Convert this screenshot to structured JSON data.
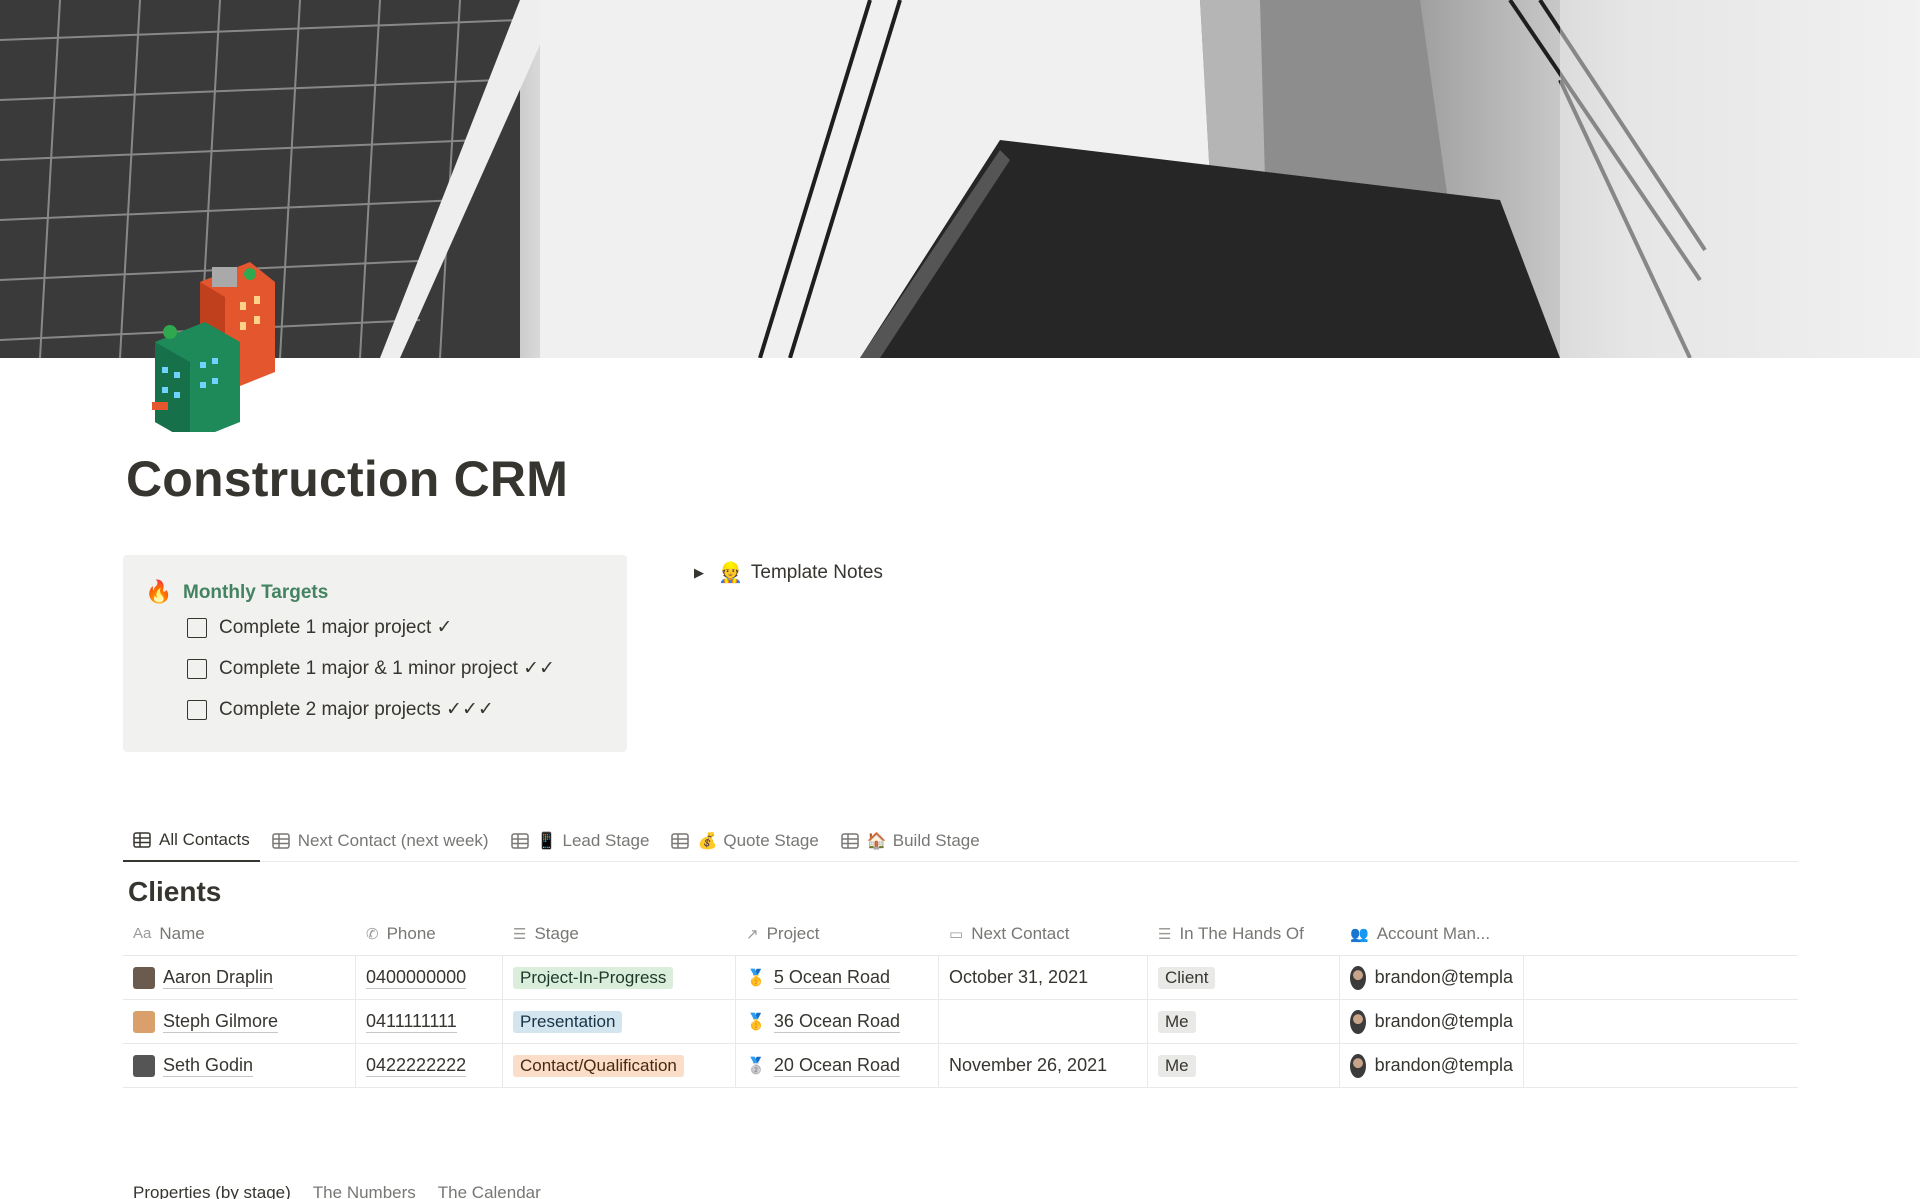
{
  "page": {
    "title": "Construction CRM",
    "cover_alt": "construction-cover",
    "icon": "building-icon"
  },
  "callout": {
    "emoji": "🔥",
    "title": "Monthly Targets",
    "todos": [
      {
        "label": "Complete 1 major project ✓",
        "checked": false
      },
      {
        "label": "Complete 1 major & 1 minor project ✓✓",
        "checked": false
      },
      {
        "label": "Complete 2 major projects ✓✓✓",
        "checked": false
      }
    ]
  },
  "toggle": {
    "emoji": "👷",
    "label": "Template Notes"
  },
  "views": {
    "tabs": [
      {
        "label": "All Contacts",
        "emoji": "",
        "active": true
      },
      {
        "label": "Next Contact (next week)",
        "emoji": "",
        "active": false
      },
      {
        "label": "Lead Stage",
        "emoji": "📱",
        "active": false
      },
      {
        "label": "Quote Stage",
        "emoji": "💰",
        "active": false
      },
      {
        "label": "Build Stage",
        "emoji": "🏠",
        "active": false
      }
    ]
  },
  "database": {
    "title": "Clients",
    "columns": [
      "Name",
      "Phone",
      "Stage",
      "Project",
      "Next Contact",
      "In The Hands Of",
      "Account Man..."
    ],
    "rows": [
      {
        "name": "Aaron Draplin",
        "phone": "0400000000",
        "stage": "Project-In-Progress",
        "stage_color": "#dbeddb",
        "stage_text": "#1c3829",
        "project": "5 Ocean Road",
        "medal": "🥇",
        "next_contact": "October 31, 2021",
        "hands": "Client",
        "account": "brandon@templa"
      },
      {
        "name": "Steph Gilmore",
        "phone": "0411111111",
        "stage": "Presentation",
        "stage_color": "#d3e5ef",
        "stage_text": "#183347",
        "project": "36 Ocean Road",
        "medal": "🥇",
        "next_contact": "",
        "hands": "Me",
        "account": "brandon@templa"
      },
      {
        "name": "Seth Godin",
        "phone": "0422222222",
        "stage": "Contact/Qualification",
        "stage_color": "#fadec9",
        "stage_text": "#49290e",
        "project": "20 Ocean Road",
        "medal": "🥈",
        "next_contact": "November 26, 2021",
        "hands": "Me",
        "account": "brandon@templa"
      }
    ]
  },
  "bottom_views": {
    "tabs": [
      "Properties (by stage)",
      "The Numbers",
      "The Calendar"
    ]
  },
  "colors": {
    "accent_green": "#448361",
    "callout_bg": "#f1f1ef",
    "tag_gray": "#e9e9e7"
  }
}
